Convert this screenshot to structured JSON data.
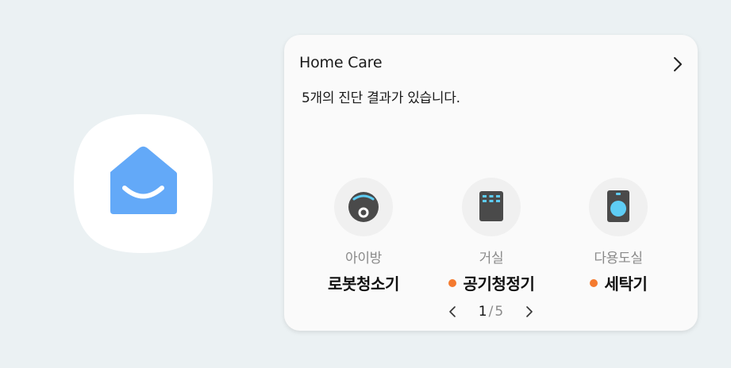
{
  "colors": {
    "accent": "#63a9f8",
    "alert": "#f47a2f",
    "device_screen": "#5ecdf5"
  },
  "app": {
    "icon": "home-care-icon"
  },
  "widget": {
    "title": "Home Care",
    "subtitle": "5개의 진단 결과가 있습니다.",
    "devices": [
      {
        "room": "아이방",
        "name": "로봇청소기",
        "icon": "robot-vacuum-icon",
        "alert": false
      },
      {
        "room": "거실",
        "name": "공기청정기",
        "icon": "air-purifier-icon",
        "alert": true
      },
      {
        "room": "다용도실",
        "name": "세탁기",
        "icon": "washing-machine-icon",
        "alert": true
      }
    ],
    "pager": {
      "current": "1",
      "separator": "/",
      "total": "5"
    }
  }
}
